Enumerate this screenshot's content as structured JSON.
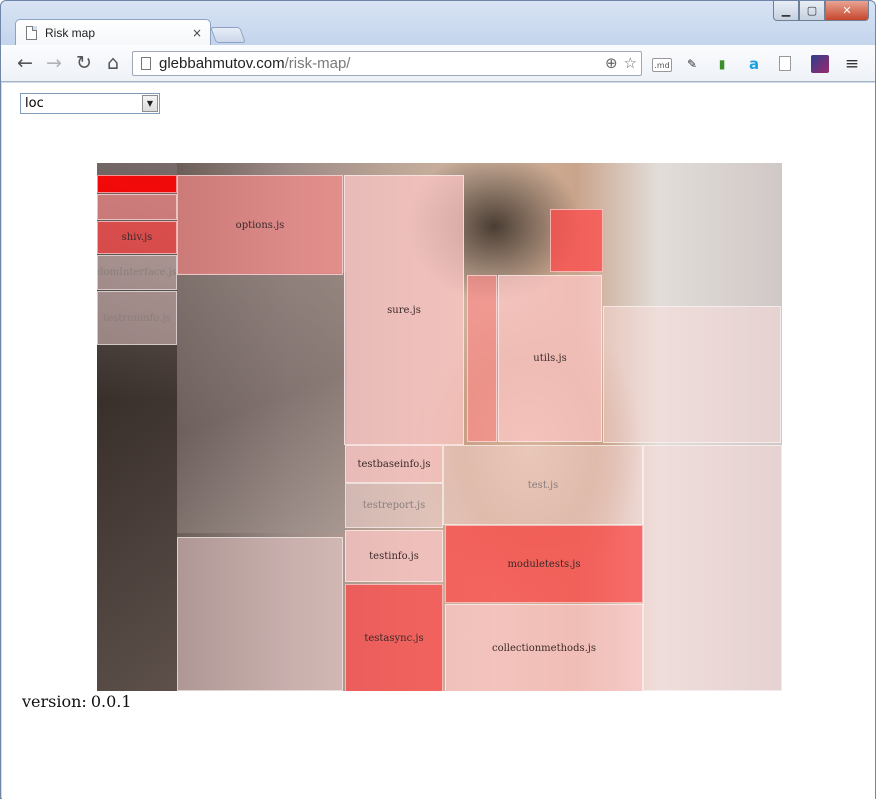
{
  "window": {
    "tab_title": "Risk map",
    "close_label": "×"
  },
  "toolbar": {
    "url_host": "glebbahmutov.com",
    "url_path": "/risk-map/",
    "md_extension_label": ".md"
  },
  "page": {
    "metric_select_value": "loc",
    "version_label": "version:",
    "version_value": "0.0.1"
  },
  "risk_map": {
    "colors": {
      "high": "#ff0000",
      "medium_high": "#ff4a4a",
      "medium": "#ff8a8a",
      "low": "#ffc7c7",
      "minimal": "#ffdede"
    },
    "files": [
      {
        "label": "",
        "risk": "high"
      },
      {
        "label": "",
        "risk": "medium"
      },
      {
        "label": "shiv.js",
        "risk": "medium_high"
      },
      {
        "label": "domInterface.js",
        "risk": "minimal"
      },
      {
        "label": "testruninfo.js",
        "risk": "minimal"
      },
      {
        "label": "options.js",
        "risk": "medium"
      },
      {
        "label": "sure.js",
        "risk": "low"
      },
      {
        "label": "",
        "risk": "medium"
      },
      {
        "label": "",
        "risk": "medium_high"
      },
      {
        "label": "utils.js",
        "risk": "low"
      },
      {
        "label": "",
        "risk": "minimal"
      },
      {
        "label": "testbaseinfo.js",
        "risk": "low"
      },
      {
        "label": "test.js",
        "risk": "minimal"
      },
      {
        "label": "testreport.js",
        "risk": "minimal"
      },
      {
        "label": "testinfo.js",
        "risk": "low"
      },
      {
        "label": "moduletests.js",
        "risk": "medium_high"
      },
      {
        "label": "testasync.js",
        "risk": "medium_high"
      },
      {
        "label": "collectionmethods.js",
        "risk": "low"
      },
      {
        "label": "",
        "risk": "minimal"
      },
      {
        "label": "",
        "risk": "minimal"
      }
    ]
  }
}
